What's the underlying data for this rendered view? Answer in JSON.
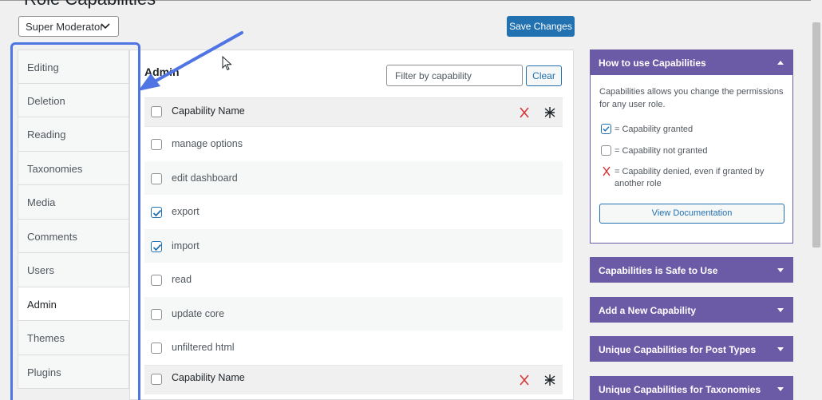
{
  "page": {
    "title": "Role Capabilities"
  },
  "role_select": {
    "value": "Super Moderator"
  },
  "toolbar": {
    "save_label": "Save Changes"
  },
  "tabs": [
    {
      "label": "Editing",
      "active": false
    },
    {
      "label": "Deletion",
      "active": false
    },
    {
      "label": "Reading",
      "active": false
    },
    {
      "label": "Taxonomies",
      "active": false
    },
    {
      "label": "Media",
      "active": false
    },
    {
      "label": "Comments",
      "active": false
    },
    {
      "label": "Users",
      "active": false
    },
    {
      "label": "Admin",
      "active": true
    },
    {
      "label": "Themes",
      "active": false
    },
    {
      "label": "Plugins",
      "active": false
    }
  ],
  "main": {
    "section_title": "Admin",
    "filter_placeholder": "Filter by capability",
    "clear_label": "Clear",
    "header_label": "Capability Name",
    "footer_label": "Capability Name",
    "deny_icon": "x-icon",
    "asterisk_icon": "asterisk-icon",
    "rows": [
      {
        "label": "manage options",
        "checked": false
      },
      {
        "label": "edit dashboard",
        "checked": false
      },
      {
        "label": "export",
        "checked": true
      },
      {
        "label": "import",
        "checked": true
      },
      {
        "label": "read",
        "checked": false
      },
      {
        "label": "update core",
        "checked": false
      },
      {
        "label": "unfiltered html",
        "checked": false
      }
    ]
  },
  "help": {
    "title": "How to use Capabilities",
    "intro": "Capabilities allows you change the permissions for any user role.",
    "legend_granted": "= Capability granted",
    "legend_not_granted": "= Capability not granted",
    "legend_denied": "= Capability denied, even if granted by another role",
    "doc_button": "View Documentation"
  },
  "sidebar_panels": [
    {
      "title": "Capabilities is Safe to Use"
    },
    {
      "title": "Add a New Capability"
    },
    {
      "title": "Unique Capabilities for Post Types"
    },
    {
      "title": "Unique Capabilities for Taxonomies"
    }
  ],
  "colors": {
    "accent": "#2271b1",
    "panel_header": "#6b5aa6",
    "highlight": "#4f74e3",
    "deny": "#d63638"
  }
}
